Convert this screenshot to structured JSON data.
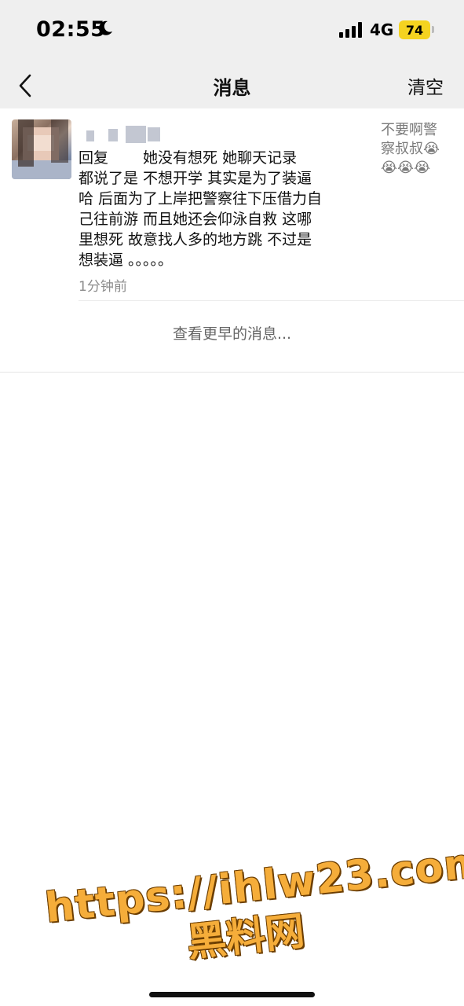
{
  "status_bar": {
    "time": "02:55",
    "network": "4G",
    "battery": "74"
  },
  "nav": {
    "title": "消息",
    "clear_label": "清空"
  },
  "message": {
    "text": "回复 　　她没有想死 她聊天记录\n都说了是 不想开学 其实是为了装逼\n哈 后面为了上岸把警察往下压借力自\n己往前游 而且她还会仰泳自救 这哪\n里想死 故意找人多的地方跳 不过是\n想装逼 。。。。。",
    "time": "1分钟前",
    "quoted_comment": "不要啊警\n察叔叔😭\n😭😭😭"
  },
  "earlier_link": "查看更早的消息...",
  "watermark": {
    "url": "https://ihlw23.com",
    "name": "黑料网"
  },
  "colors": {
    "bar_bg": "#efefef",
    "battery": "#f5d320",
    "watermark": "#f5ad3a"
  }
}
